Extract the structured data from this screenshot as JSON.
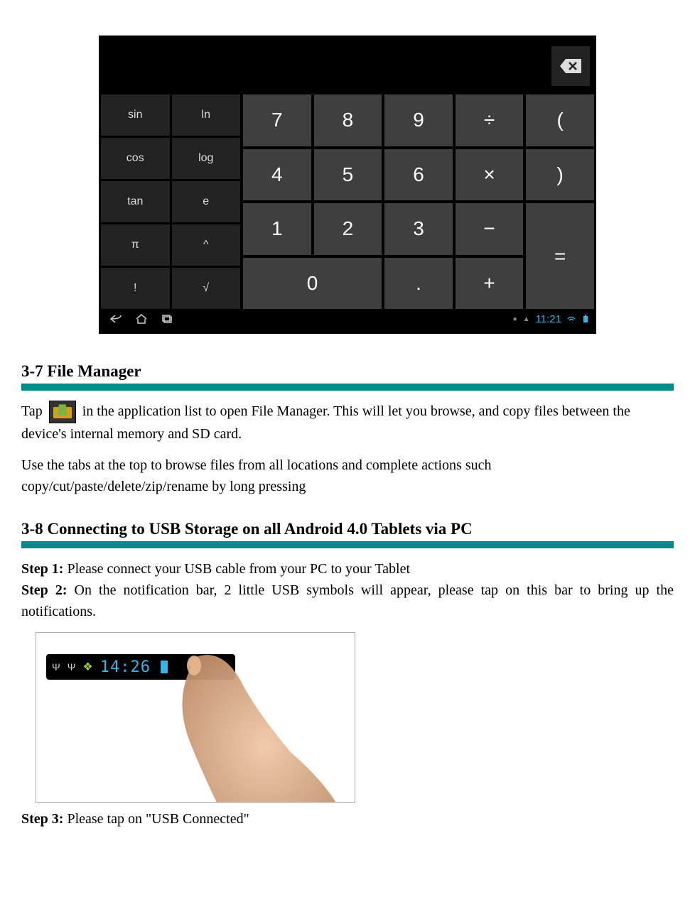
{
  "calculator": {
    "sci": [
      "sin",
      "ln",
      "cos",
      "log",
      "tan",
      "e",
      "π",
      "^",
      "!",
      "√"
    ],
    "num_row1": [
      "7",
      "8",
      "9",
      "÷",
      "("
    ],
    "num_row2": [
      "4",
      "5",
      "6",
      "×",
      ")"
    ],
    "num_row3": [
      "1",
      "2",
      "3",
      "−"
    ],
    "num_row4_zero": "0",
    "num_row4_dot": ".",
    "num_row4_plus": "+",
    "num_eq": "=",
    "status_time": "11:21"
  },
  "section1": {
    "title": "3-7 File Manager",
    "para1_pre": "Tap",
    "para1_post": " in the application list to open File Manager. This will let you browse, and copy files between the device's internal memory and SD card.",
    "para2": "Use the tabs at the top to browse files from all locations and complete actions such copy/cut/paste/delete/zip/rename by long pressing"
  },
  "section2": {
    "title": "3-8 Connecting to USB Storage on all Android 4.0 Tablets via PC",
    "step1_label": "Step 1:",
    "step1_text": "   Please connect your USB cable from your PC to your Tablet",
    "step2_label": "Step 2:",
    "step2_text": "   On the notification bar, 2 little USB symbols will appear, please tap on this bar to bring up the notifications.",
    "notif_time": "14:26",
    "step3_label": "Step 3:",
    "step3_text": "   Please tap on \"USB Connected\""
  }
}
